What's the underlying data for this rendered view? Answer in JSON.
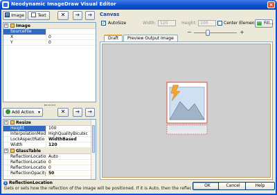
{
  "window": {
    "title": "Neodynamic ImageDraw Visual Editor",
    "close": "×"
  },
  "toolbar_top": {
    "image_label": "Image",
    "text_label": "Text",
    "delete_glyph": "✕",
    "up_glyph": "➔",
    "down_glyph": "➔"
  },
  "elements_grid": {
    "category": "Image",
    "rows": [
      {
        "name": "SourceFile",
        "value": "",
        "selected": true
      },
      {
        "name": "X",
        "value": "0"
      },
      {
        "name": "Y",
        "value": "0"
      }
    ]
  },
  "toolbar_actions": {
    "add_action_label": "Add Action",
    "delete_glyph": "✕",
    "up_glyph": "➔",
    "down_glyph": "➔"
  },
  "actions_grid": {
    "sections": [
      {
        "name": "Resize",
        "rows": [
          {
            "name": "Height",
            "value": "100",
            "selected": true
          },
          {
            "name": "InterpolationMode",
            "value": "HighQualityBicubic"
          },
          {
            "name": "LockAspectRatio",
            "value": "WidthBased",
            "bold": true
          },
          {
            "name": "Width",
            "value": "120",
            "bold": true
          }
        ]
      },
      {
        "name": "GlassTable",
        "rows": [
          {
            "name": "ReflectionLocation",
            "value": "Auto"
          },
          {
            "name": "ReflectionLocationX",
            "value": "0"
          },
          {
            "name": "ReflectionLocationY",
            "value": "0"
          },
          {
            "name": "ReflectionOpacity",
            "value": "50",
            "bold": true
          }
        ]
      }
    ]
  },
  "canvas": {
    "title": "Canvas",
    "autosize_label": "AutoSize",
    "autosize_checked": true,
    "width_label": "Width:",
    "width_value": "120",
    "height_label": "Height:",
    "height_value": "100",
    "center_label": "Center Elements",
    "center_checked": false,
    "fill_label": "Fill...",
    "zoom_minus": "−",
    "zoom_plus": "+",
    "zoom_level": 0.3
  },
  "tabs": [
    {
      "label": "Draft",
      "active": true
    },
    {
      "label": "Preview Output Image",
      "active": false
    }
  ],
  "status": {
    "property": "ReflectionLocation",
    "description": "Gets or sets how the reflection of the image will be positioned. If it is Auto, then the reflection will be positio"
  },
  "buttons": {
    "ok": "OK",
    "cancel": "Cancel",
    "help": "Help"
  },
  "colors": {
    "titlebar": "#0a4fd0",
    "accent": "#e7a23e",
    "selection": "#316ac5",
    "canvas_bg": "#cfcfcf",
    "frame": "#d64b3a"
  }
}
